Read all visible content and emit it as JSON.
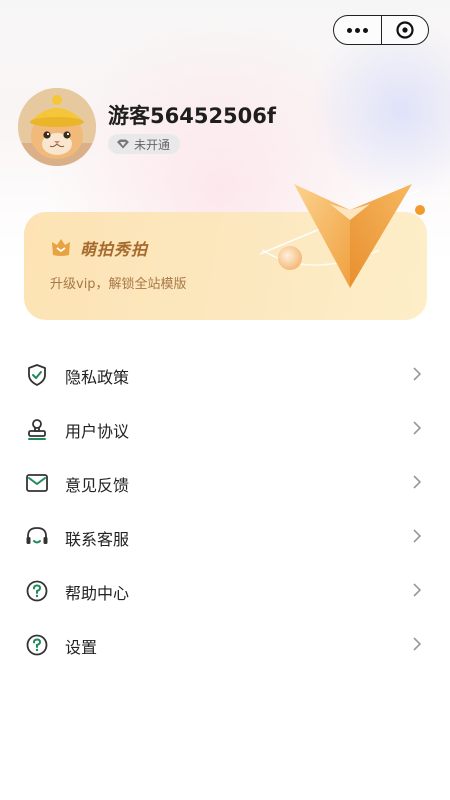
{
  "header": {
    "more_icon": "more-dots-icon",
    "close_icon": "close-circle-icon"
  },
  "profile": {
    "username": "游客56452506f",
    "vip_status": "未开通",
    "avatar": "cat-avatar"
  },
  "vip_card": {
    "title": "萌拍秀拍",
    "subtitle": "升级vip，解锁全站模版",
    "colors": {
      "card": "#fde3b4",
      "title": "#a56a2d",
      "accent": "#f0a040"
    }
  },
  "menu": {
    "items": [
      {
        "label": "隐私政策",
        "icon": "shield-check-icon"
      },
      {
        "label": "用户协议",
        "icon": "user-stamp-icon"
      },
      {
        "label": "意见反馈",
        "icon": "envelope-icon"
      },
      {
        "label": "联系客服",
        "icon": "headset-icon"
      },
      {
        "label": "帮助中心",
        "icon": "help-circle-icon"
      },
      {
        "label": "设置",
        "icon": "help-circle-icon"
      }
    ],
    "icon_color": "#1f8a5b"
  }
}
